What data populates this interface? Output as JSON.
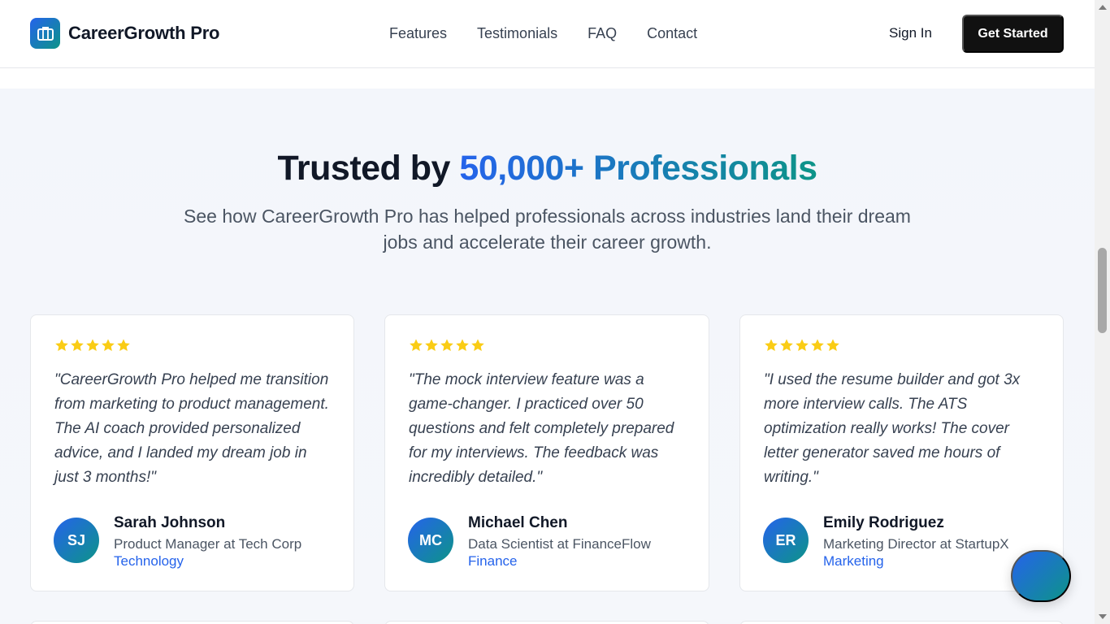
{
  "header": {
    "brand": "CareerGrowth Pro",
    "nav": [
      "Features",
      "Testimonials",
      "FAQ",
      "Contact"
    ],
    "sign_in": "Sign In",
    "get_started": "Get Started"
  },
  "section": {
    "title_prefix": "Trusted by ",
    "title_highlight": "50,000+ Professionals",
    "subtitle": "See how CareerGrowth Pro has helped professionals across industries land their dream jobs and accelerate their career growth."
  },
  "testimonials": [
    {
      "rating": 5,
      "quote": "\"CareerGrowth Pro helped me transition from marketing to product management. The AI coach provided personalized advice, and I landed my dream job in just 3 months!\"",
      "initials": "SJ",
      "name": "Sarah Johnson",
      "role": "Product Manager at Tech Corp",
      "industry": "Technology"
    },
    {
      "rating": 5,
      "quote": "\"The mock interview feature was a game-changer. I practiced over 50 questions and felt completely prepared for my interviews. The feedback was incredibly detailed.\"",
      "initials": "MC",
      "name": "Michael Chen",
      "role": "Data Scientist at FinanceFlow",
      "industry": "Finance"
    },
    {
      "rating": 5,
      "quote": "\"I used the resume builder and got 3x more interview calls. The ATS optimization really works! The cover letter generator saved me hours of writing.\"",
      "initials": "ER",
      "name": "Emily Rodriguez",
      "role": "Marketing Director at StartupX",
      "industry": "Marketing"
    }
  ],
  "colors": {
    "accent_blue": "#2563eb",
    "accent_teal": "#0d9488",
    "star": "#facc15",
    "button_dark": "#111111"
  },
  "icons": {
    "logo": "briefcase-icon",
    "rating": "star-icon",
    "chat": "chat-button"
  }
}
